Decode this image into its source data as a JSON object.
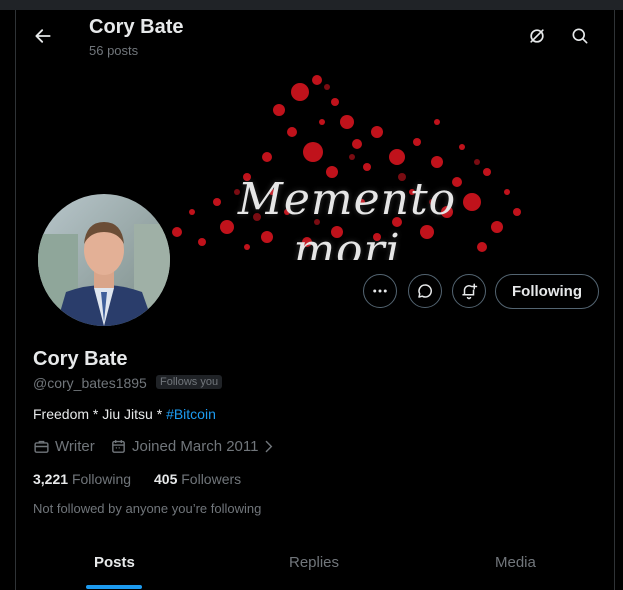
{
  "header": {
    "title": "Cory Bate",
    "post_count": "56 posts"
  },
  "banner": {
    "text": "Memento mori"
  },
  "actions": {
    "following_label": "Following"
  },
  "profile": {
    "name": "Cory Bate",
    "handle": "@cory_bates1895",
    "follows_you": "Follows you",
    "bio_prefix": "Freedom * Jiu Jitsu * ",
    "bio_hashtag": "#Bitcoin",
    "profession": "Writer",
    "joined": "Joined March 2011",
    "following_count": "3,221",
    "following_label": "Following",
    "followers_count": "405",
    "followers_label": "Followers",
    "mutuals_text": "Not followed by anyone you’re following"
  },
  "tabs": [
    {
      "label": "Posts",
      "active": true
    },
    {
      "label": "Replies"
    },
    {
      "label": "Media"
    }
  ],
  "colors": {
    "accent": "#1d9bf0",
    "background": "#000000",
    "muted": "#71767b",
    "banner_splatter": "#c0121b"
  },
  "icons": [
    "back-arrow-icon",
    "grok-icon",
    "search-icon",
    "more-icon",
    "message-icon",
    "notification-bell-icon",
    "briefcase-icon",
    "calendar-icon",
    "chevron-right-icon"
  ]
}
